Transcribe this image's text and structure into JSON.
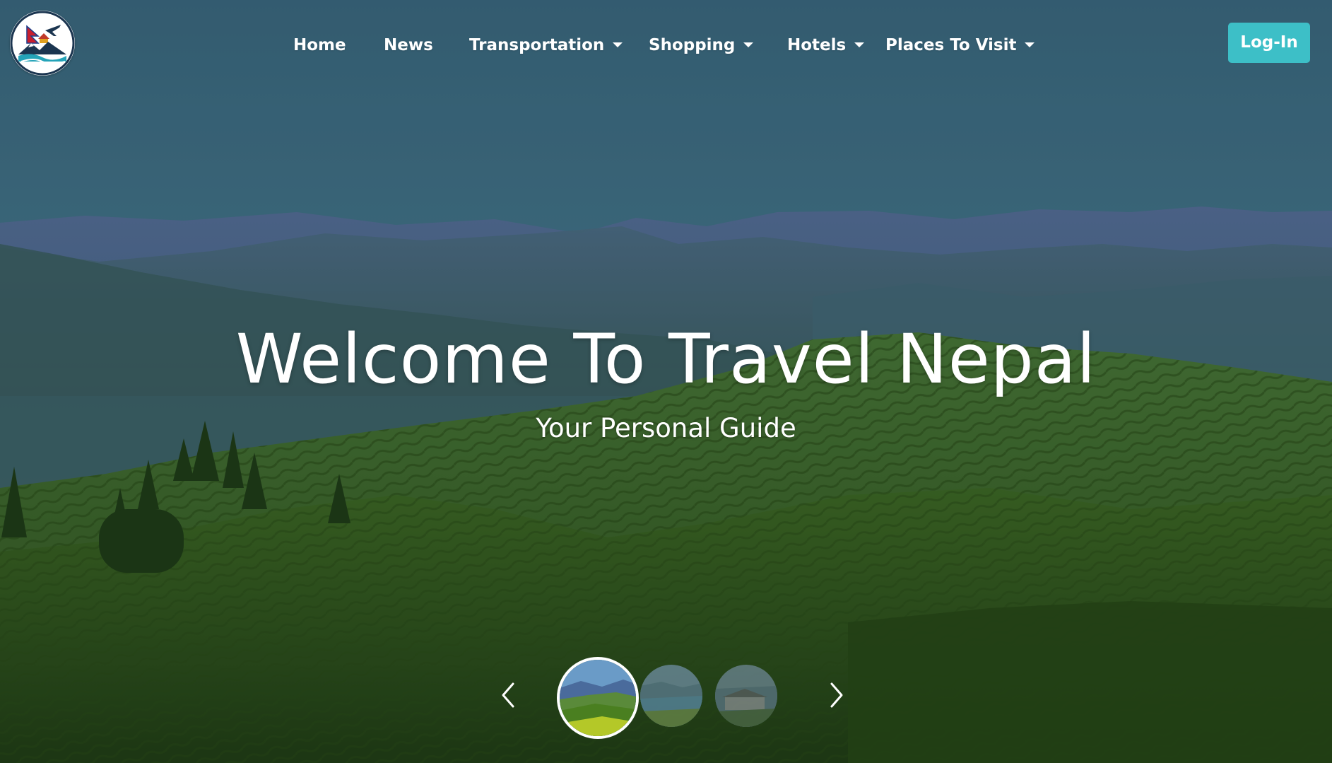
{
  "site": {
    "logo": "travel-nepal-logo"
  },
  "nav": {
    "items": [
      {
        "label": "Home",
        "dropdown": false
      },
      {
        "label": "News",
        "dropdown": false
      },
      {
        "label": "Transportation",
        "dropdown": true
      },
      {
        "label": "Shopping",
        "dropdown": true
      },
      {
        "label": "Hotels",
        "dropdown": true
      },
      {
        "label": "Places To Visit",
        "dropdown": true
      }
    ],
    "login_label": "Log-In"
  },
  "hero": {
    "title": "Welcome To Travel Nepal",
    "subtitle": "Your Personal Guide"
  },
  "carousel": {
    "prev_icon": "chevron-left-icon",
    "next_icon": "chevron-right-icon",
    "slide_count": 3,
    "active_index": 0
  },
  "colors": {
    "accent": "#3dbfc7",
    "nav_text": "#ffffff",
    "sky": "#3f6e83"
  }
}
